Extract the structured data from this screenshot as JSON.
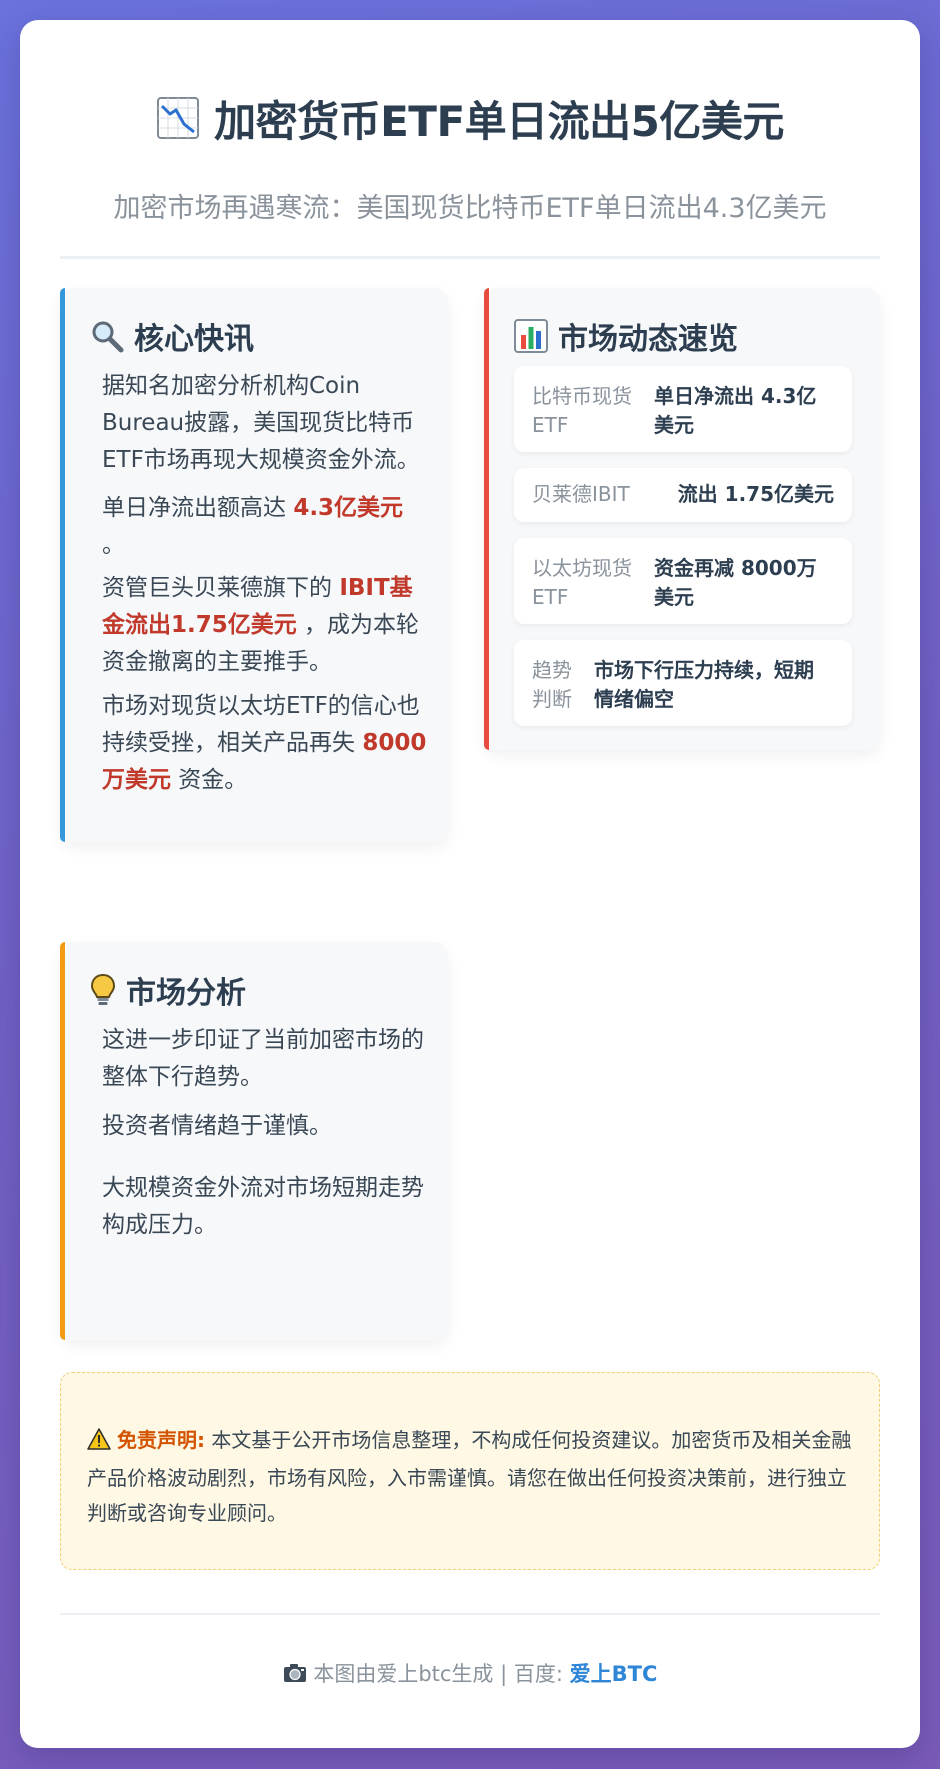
{
  "header": {
    "title_icon": "chart-decreasing-icon",
    "title": "加密货币ETF单日流出5亿美元",
    "subtitle": "加密市场再遇寒流：美国现货比特币ETF单日流出4.3亿美元"
  },
  "colors": {
    "accent_blue": "#3498db",
    "accent_red": "#e74c3c",
    "accent_orange": "#f39c12",
    "highlight_red": "#c0392b",
    "brand_blue": "#2f86d6"
  },
  "core_news": {
    "icon": "magnifier-icon",
    "title": "核心快讯",
    "p1": "据知名加密分析机构Coin Bureau披露，美国现货比特币ETF市场再现大规模资金外流。",
    "p2_prefix": "单日净流出额高达 ",
    "p2_highlight": "4.3亿美元",
    "p2_suffix": " 。",
    "p3_prefix": "资管巨头贝莱德旗下的 ",
    "p3_highlight": "IBIT基金流出1.75亿美元",
    "p3_suffix": " ，成为本轮资金撤离的主要推手。",
    "p4_prefix": "市场对现货以太坊ETF的信心也持续受挫，相关产品再失 ",
    "p4_highlight": "8000万美元",
    "p4_suffix": " 资金。"
  },
  "market_overview": {
    "icon": "bar-chart-icon",
    "title": "市场动态速览",
    "items": [
      {
        "label": "比特币现货ETF",
        "value": "单日净流出 4.3亿美元"
      },
      {
        "label": "贝莱德IBIT",
        "value": "流出 1.75亿美元"
      },
      {
        "label": "以太坊现货ETF",
        "value": "资金再减 8000万美元"
      },
      {
        "label": "趋势判断",
        "value": "市场下行压力持续，短期情绪偏空"
      }
    ]
  },
  "analysis": {
    "icon": "lightbulb-icon",
    "title": "市场分析",
    "p1": "这进一步印证了当前加密市场的整体下行趋势。",
    "p2": "投资者情绪趋于谨慎。",
    "p3": "大规模资金外流对市场短期走势构成压力。"
  },
  "disclaimer": {
    "icon": "warning-icon",
    "label": "免责声明:",
    "text": " 本文基于公开市场信息整理，不构成任何投资建议。加密货币及相关金融产品价格波动剧烈，市场有风险，入市需谨慎。请您在做出任何投资决策前，进行独立判断或咨询专业顾问。"
  },
  "footer": {
    "icon": "camera-icon",
    "text": " 本图由爱上btc生成 | 百度: ",
    "brand": "爱上BTC"
  }
}
